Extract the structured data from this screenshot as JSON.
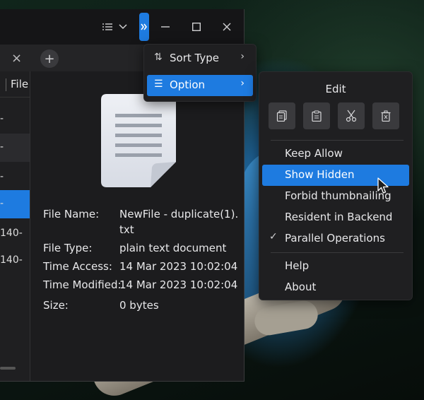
{
  "titlebar": {
    "view_icon": "list-view-icon",
    "dropdown_icon": "chevron-down-icon",
    "more_icon": "double-chevron-right-icon",
    "minimize_icon": "minimize-icon",
    "maximize_icon": "maximize-icon",
    "close_icon": "close-icon"
  },
  "tabbar": {
    "close_symbol": "×",
    "add_symbol": "+"
  },
  "sidebar": {
    "header_label": "File",
    "rows": [
      {
        "label": "-"
      },
      {
        "label": "-"
      },
      {
        "label": "-"
      },
      {
        "label": "-"
      },
      {
        "label": "140-"
      },
      {
        "label": "140-"
      }
    ]
  },
  "details": {
    "file_name_label": "File Name:",
    "file_name_value": "NewFile - duplicate(1).txt",
    "file_type_label": "File Type:",
    "file_type_value": "plain text document",
    "time_access_label": "Time Access:",
    "time_access_value": "14 Mar 2023 10:02:04",
    "time_modified_label": "Time Modified:",
    "time_modified_value": "14 Mar 2023 10:02:04",
    "size_label": "Size:",
    "size_value": "0 bytes"
  },
  "menu_main": {
    "items": [
      {
        "label": "Sort Type",
        "icon": "sort-icon"
      },
      {
        "label": "Option",
        "icon": "menu-lines-icon"
      }
    ]
  },
  "menu_option": {
    "edit_title": "Edit",
    "edit_buttons": [
      "copy-icon",
      "paste-icon",
      "cut-icon",
      "delete-icon"
    ],
    "items": [
      {
        "label": "Keep Allow",
        "checked": false
      },
      {
        "label": "Show Hidden",
        "checked": false
      },
      {
        "label": "Forbid thumbnailing",
        "checked": false
      },
      {
        "label": "Resident in Backend",
        "checked": false
      },
      {
        "label": "Parallel Operations",
        "checked": true
      }
    ],
    "footer_items": [
      {
        "label": "Help"
      },
      {
        "label": "About"
      }
    ]
  },
  "colors": {
    "accent": "#1e7be0",
    "menu_bg": "#1f1f21",
    "window_bg": "#1c1c1e"
  }
}
